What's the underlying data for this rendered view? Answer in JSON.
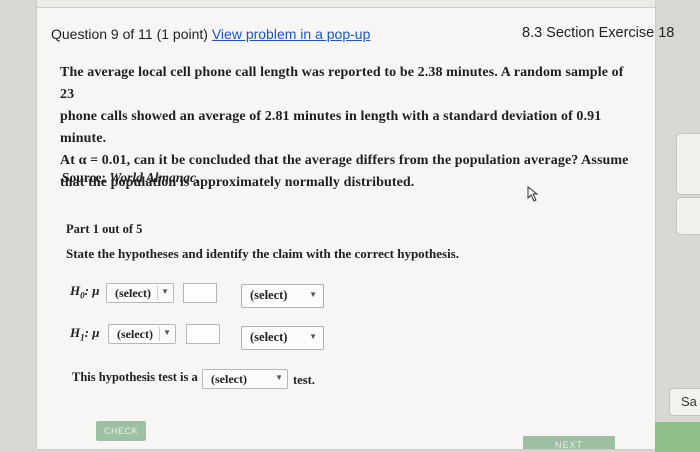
{
  "header": {
    "question_label": "Question 9 of 11 (1 point)",
    "popup_link": "View problem in a pop-up",
    "section": "8.3 Section Exercise 18"
  },
  "problem": {
    "line1": "The average local cell phone call length was reported to be 2.38 minutes. A random sample of 23",
    "line2": "phone calls showed an average of 2.81 minutes in length with a standard deviation of 0.91 minute.",
    "line3": "At α = 0.01, can it be concluded that the average differs from the population average? Assume",
    "line4": "that the population is approximately normally distributed."
  },
  "source": {
    "label": "Source:",
    "name": "World Almanac."
  },
  "part": {
    "label": "Part 1 out of 5",
    "instruction": "State the hypotheses and identify the claim with the correct hypothesis."
  },
  "hypotheses": {
    "h0_label": "H",
    "h0_sub": "0",
    "h0_mu": ": μ",
    "h0_select": "(select)",
    "h0_claim_select": "(select)",
    "h1_label": "H",
    "h1_sub": "1",
    "h1_mu": ": μ",
    "h1_select": "(select)",
    "h1_claim_select": "(select)"
  },
  "test": {
    "prefix": "This hypothesis test is a",
    "select": "(select)",
    "suffix": "test."
  },
  "buttons": {
    "check": "CHECK",
    "next": "NEXT",
    "save": "Sa"
  },
  "icons": {
    "dropdown": "▼",
    "cursor": "pointer-hand-icon"
  }
}
